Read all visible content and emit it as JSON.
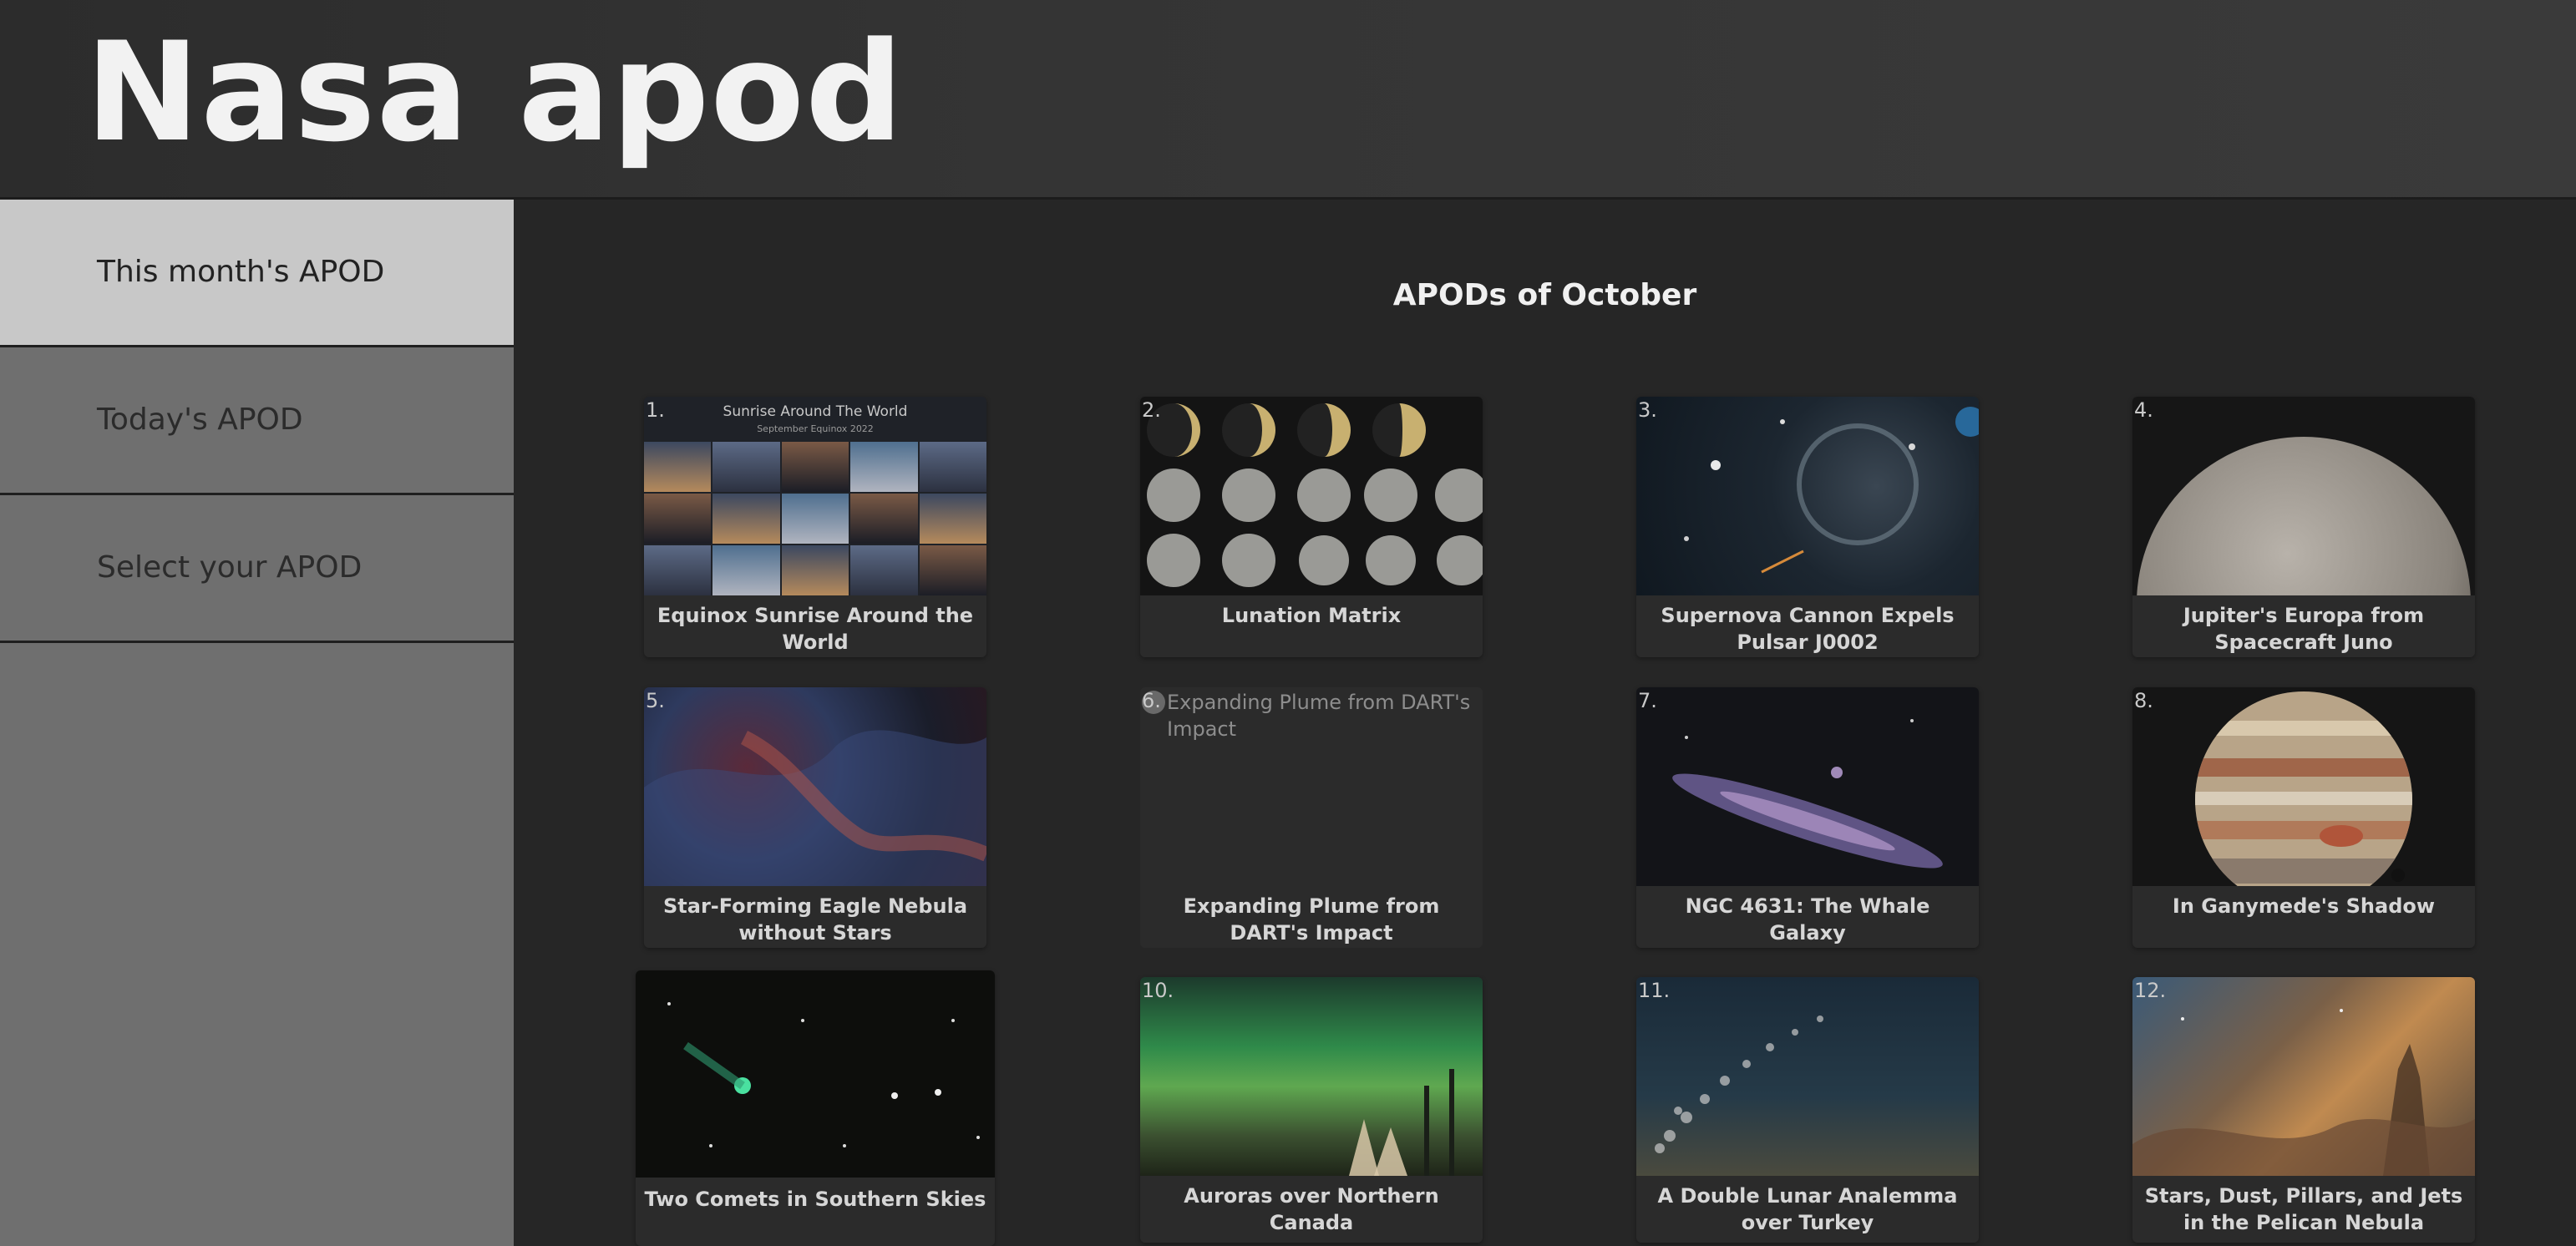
{
  "header": {
    "title": "Nasa apod"
  },
  "sidebar": {
    "items": [
      {
        "label": "This month's APOD",
        "active": true
      },
      {
        "label": "Today's APOD",
        "active": false
      },
      {
        "label": "Select your APOD",
        "active": false
      }
    ]
  },
  "main": {
    "heading": "APODs of October",
    "cards": [
      {
        "num": "1.",
        "title": "Equinox Sunrise Around the World"
      },
      {
        "num": "2.",
        "title": "Lunation Matrix"
      },
      {
        "num": "3.",
        "title": "Supernova Cannon Expels Pulsar J0002"
      },
      {
        "num": "4.",
        "title": "Jupiter's Europa from Spacecraft Juno"
      },
      {
        "num": "5.",
        "title": "Star-Forming Eagle Nebula without Stars"
      },
      {
        "num": "6.",
        "title": "Expanding Plume from DART's Impact",
        "alt": "Expanding Plume from DART's Impact"
      },
      {
        "num": "7.",
        "title": "NGC 4631: The Whale Galaxy"
      },
      {
        "num": "8.",
        "title": "In Ganymede's Shadow"
      },
      {
        "num": "",
        "title": "Two Comets in Southern Skies"
      },
      {
        "num": "10.",
        "title": "Auroras over Northern Canada"
      },
      {
        "num": "11.",
        "title": "A Double Lunar Analemma over Turkey"
      },
      {
        "num": "12.",
        "title": "Stars, Dust, Pillars, and Jets in the Pelican Nebula"
      }
    ],
    "thumb1": {
      "title": "Sunrise Around The World",
      "subtitle": "September Equinox 2022"
    }
  }
}
